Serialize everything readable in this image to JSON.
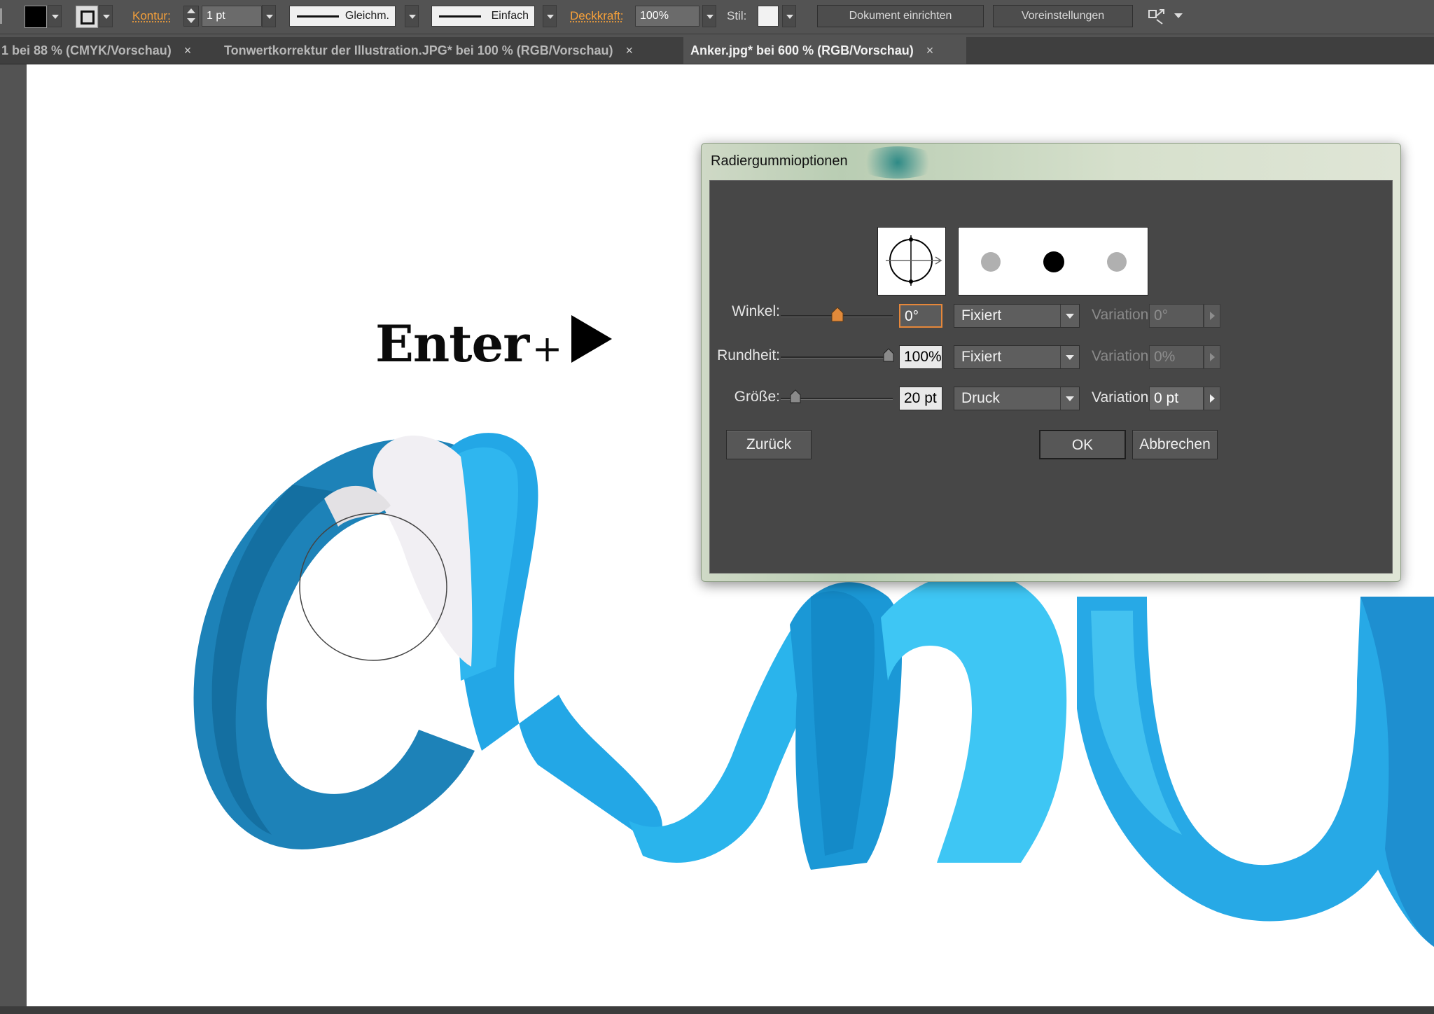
{
  "control_bar": {
    "contour_label": "Kontur:",
    "contour_value": "1 pt",
    "stroke_profile": "Gleichm.",
    "brush_definition": "Einfach",
    "opacity_label": "Deckkraft:",
    "opacity_value": "100%",
    "style_label": "Stil:",
    "document_setup_button": "Dokument einrichten",
    "preferences_button": "Voreinstellungen"
  },
  "tabs": [
    {
      "label": "1 bei 88 % (CMYK/Vorschau)",
      "active": false
    },
    {
      "label": "Tonwertkorrektur der Illustration.JPG* bei 100 % (RGB/Vorschau)",
      "active": false
    },
    {
      "label": "Anker.jpg* bei 600 % (RGB/Vorschau)",
      "active": true
    }
  ],
  "tab_close_glyph": "×",
  "overlay": {
    "enter_text": "Enter",
    "plus": "+"
  },
  "dialog": {
    "title": "Radiergummioptionen",
    "angle": {
      "label": "Winkel:",
      "value": "0°",
      "mode": "Fixiert",
      "variation_label": "Variation:",
      "variation_value": "0°",
      "slider_position": 0.5
    },
    "roundness": {
      "label": "Rundheit:",
      "value": "100%",
      "mode": "Fixiert",
      "variation_label": "Variation:",
      "variation_value": "0%",
      "slider_position": 1.0
    },
    "size": {
      "label": "Größe:",
      "value": "20 pt",
      "mode": "Druck",
      "variation_label": "Variation:",
      "variation_value": "0 pt",
      "slider_position": 0.1
    },
    "reset_button": "Zurück",
    "ok_button": "OK",
    "cancel_button": "Abbrechen"
  },
  "colors": {
    "ui_panel": "#535353",
    "accent_orange": "#f7a13a",
    "artwork_blue_dark": "#1a7fb5",
    "artwork_blue_light": "#2ab4ec"
  }
}
